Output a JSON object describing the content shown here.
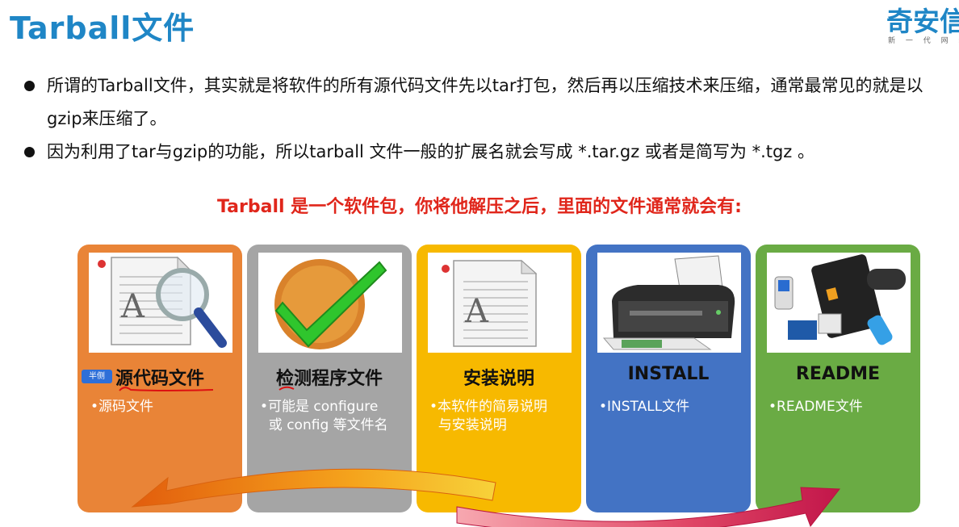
{
  "header": {
    "title": "Tarball文件"
  },
  "logo": {
    "main": "奇安信",
    "sub": "新 一 代 网 络 安 全"
  },
  "bullets": [
    "所谓的Tarball文件，其实就是将软件的所有源代码文件先以tar打包，然后再以压缩技术来压缩，通常最常见的就是以gzip来压缩了。",
    "因为利用了tar与gzip的功能，所以tarball 文件一般的扩展名就会写成 *.tar.gz 或者是简写为 *.tgz 。"
  ],
  "subtitle": "Tarball 是一个软件包，你将他解压之后，里面的文件通常就会有:",
  "overlay_tag": "半侧",
  "cards": [
    {
      "title": "源代码文件",
      "desc": "•源码文件",
      "color": "#e98437",
      "icon": "document-magnifier-icon"
    },
    {
      "title": "检测程序文件",
      "desc": "•可能是 configure\n  或 config 等文件名",
      "color": "#a5a5a5",
      "icon": "checkmark-icon"
    },
    {
      "title": "安装说明",
      "desc": "•本软件的简易说明\n  与安装说明",
      "color": "#f7b900",
      "icon": "document-icon"
    },
    {
      "title": "INSTALL",
      "desc": "•INSTALL文件",
      "color": "#4373c4",
      "icon": "printer-icon"
    },
    {
      "title": "README",
      "desc": "•README文件",
      "color": "#6aab44",
      "icon": "devices-icon"
    }
  ],
  "colors": {
    "title_blue": "#1f86c6",
    "subtitle_red": "#e0261b"
  }
}
